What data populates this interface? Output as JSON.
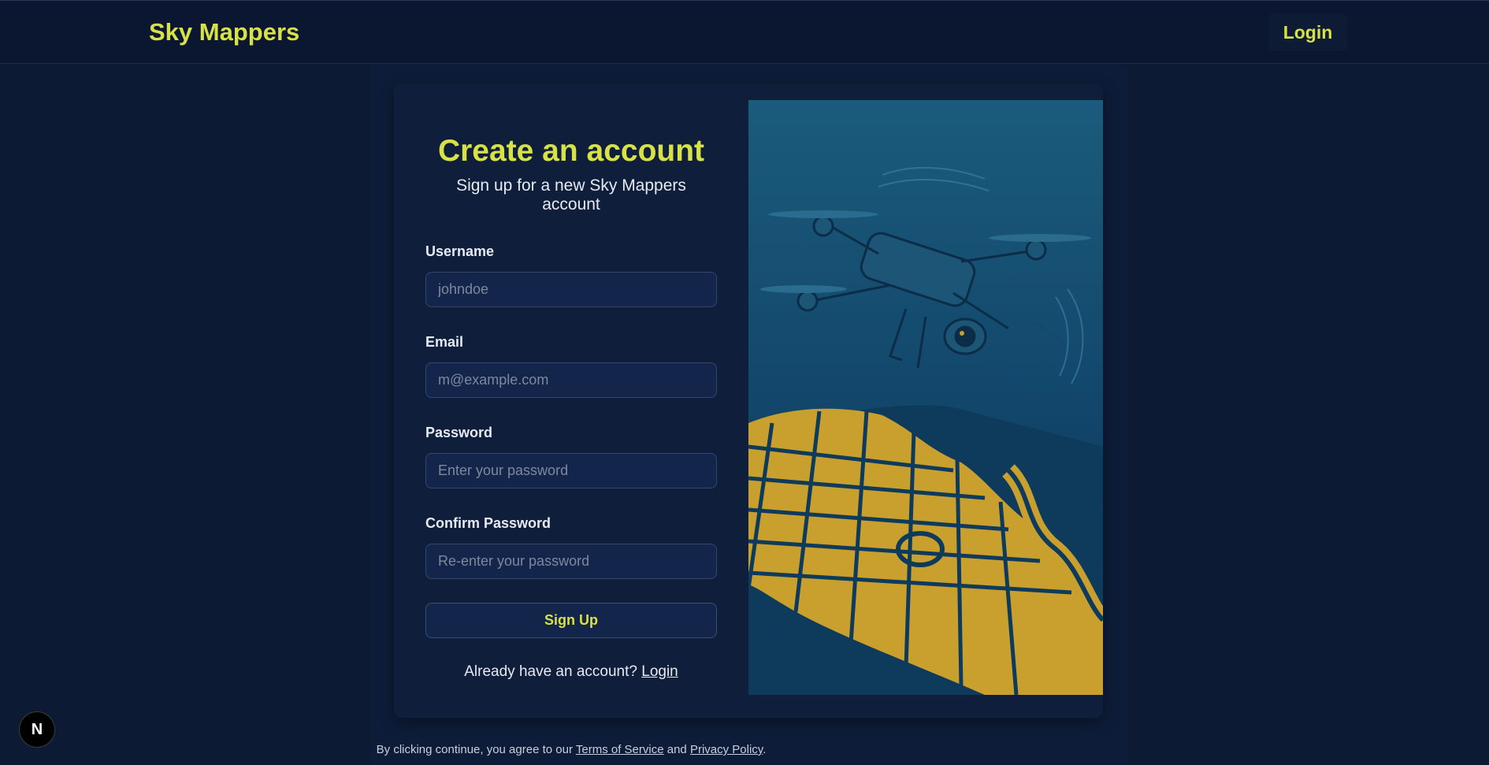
{
  "header": {
    "brand": "Sky Mappers",
    "login_label": "Login"
  },
  "form": {
    "title": "Create an account",
    "subtitle": "Sign up for a new Sky Mappers account",
    "username": {
      "label": "Username",
      "placeholder": "johndoe"
    },
    "email": {
      "label": "Email",
      "placeholder": "m@example.com"
    },
    "password": {
      "label": "Password",
      "placeholder": "Enter your password"
    },
    "confirm": {
      "label": "Confirm Password",
      "placeholder": "Re-enter your password"
    },
    "submit_label": "Sign Up",
    "already_text": "Already have an account?",
    "login_link": "Login"
  },
  "footer": {
    "prefix": "By clicking continue, you agree to our",
    "terms": "Terms of Service",
    "and": "and",
    "privacy": "Privacy Policy",
    "period": "."
  },
  "badge": {
    "letter": "N"
  },
  "hero": {
    "icon": "drone-over-city-map-illustration"
  },
  "colors": {
    "accent": "#d8e247",
    "background": "#0c1a33",
    "map_gold": "#c9a02e",
    "map_blue": "#11456b"
  }
}
